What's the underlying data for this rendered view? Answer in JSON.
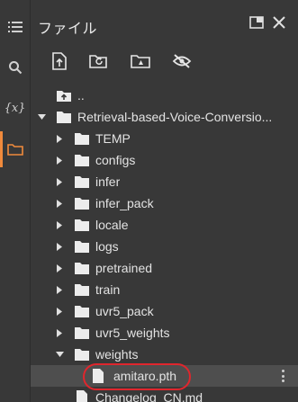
{
  "panel": {
    "title": "ファイル"
  },
  "rail": [
    "list-icon",
    "search-icon",
    "variables-icon",
    "folder-icon"
  ],
  "rail_variables_text": "{x}",
  "toolbar": [
    "upload-icon",
    "refresh-folder-icon",
    "drive-icon",
    "hide-icon"
  ],
  "tree": {
    "up": "..",
    "root": "Retrieval-based-Voice-Conversio...",
    "folders": [
      "TEMP",
      "configs",
      "infer",
      "infer_pack",
      "locale",
      "logs",
      "pretrained",
      "train",
      "uvr5_pack",
      "uvr5_weights"
    ],
    "open_folder": "weights",
    "selected_file": "amitaro.pth",
    "partial_file": "Changelog_CN.md"
  },
  "colors": {
    "background": "#383838",
    "selected": "#4e4e4e",
    "accent": "#f08a3c",
    "highlight": "#e0262d"
  }
}
